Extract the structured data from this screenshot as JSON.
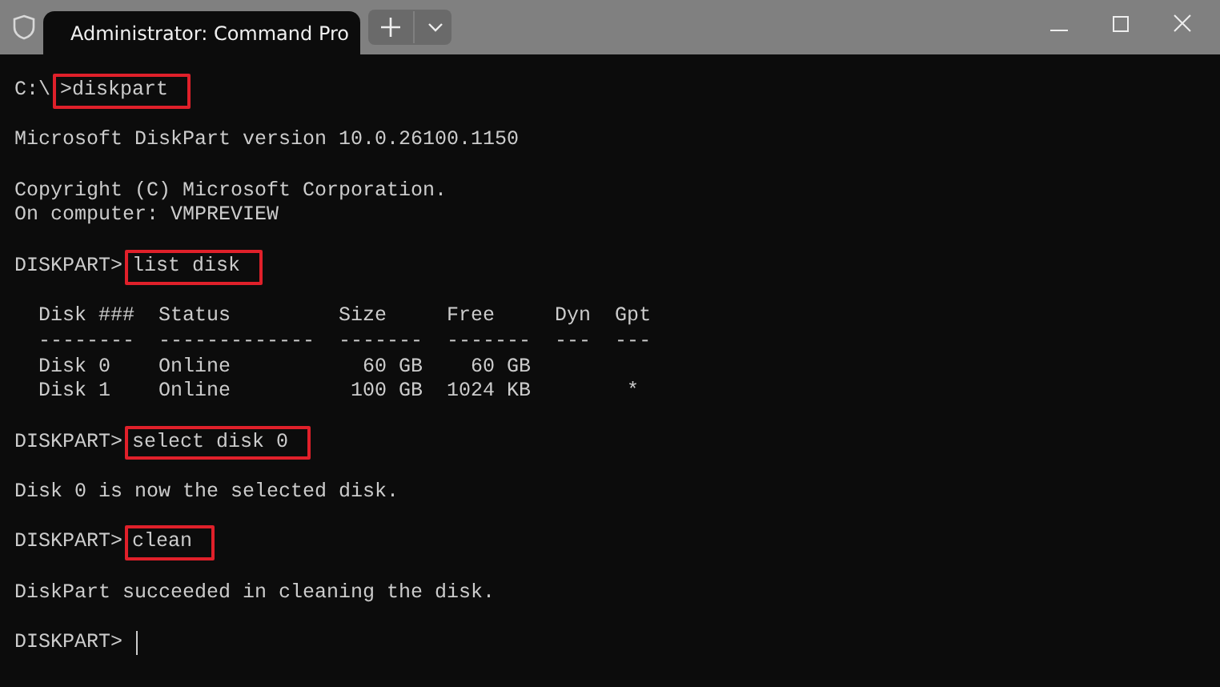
{
  "tab": {
    "title": "Administrator: Command Pro",
    "selected": true
  },
  "lines": [
    {
      "kind": "prompt",
      "prompt": "C:\\",
      "command": ">diskpart",
      "highlighted": true
    },
    {
      "kind": "blank"
    },
    {
      "kind": "output",
      "text": "Microsoft DiskPart version 10.0.26100.1150"
    },
    {
      "kind": "blank"
    },
    {
      "kind": "output",
      "text": "Copyright (C) Microsoft Corporation."
    },
    {
      "kind": "output",
      "text": "On computer: VMPREVIEW"
    },
    {
      "kind": "blank"
    },
    {
      "kind": "prompt",
      "prompt": "DISKPART>",
      "command": "list disk",
      "highlighted": true
    },
    {
      "kind": "blank"
    },
    {
      "kind": "output",
      "text": "  Disk ###  Status         Size     Free     Dyn  Gpt"
    },
    {
      "kind": "output",
      "text": "  --------  -------------  -------  -------  ---  ---"
    },
    {
      "kind": "output",
      "text": "  Disk 0    Online           60 GB    60 GB"
    },
    {
      "kind": "output",
      "text": "  Disk 1    Online          100 GB  1024 KB        *"
    },
    {
      "kind": "blank"
    },
    {
      "kind": "prompt",
      "prompt": "DISKPART>",
      "command": "select disk 0",
      "highlighted": true
    },
    {
      "kind": "blank"
    },
    {
      "kind": "output",
      "text": "Disk 0 is now the selected disk."
    },
    {
      "kind": "blank"
    },
    {
      "kind": "prompt",
      "prompt": "DISKPART>",
      "command": "clean",
      "highlighted": true
    },
    {
      "kind": "blank"
    },
    {
      "kind": "output",
      "text": "DiskPart succeeded in cleaning the disk."
    },
    {
      "kind": "blank"
    },
    {
      "kind": "prompt",
      "prompt": "DISKPART>",
      "cursor": true
    }
  ]
}
